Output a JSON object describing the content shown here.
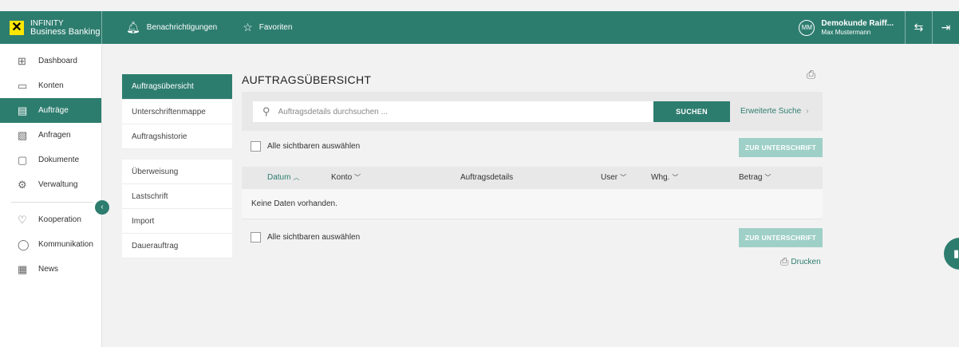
{
  "brand": {
    "line1": "INFINITY",
    "line2": "Business Banking",
    "logo": "✕"
  },
  "topnav": {
    "notifications": "Benachrichtigungen",
    "favorites": "Favoriten"
  },
  "user": {
    "initials": "MM",
    "company": "Demokunde Raiff...",
    "name": "Max Mustermann"
  },
  "sidebar": {
    "items": [
      {
        "label": "Dashboard",
        "icon": "dashboard-icon"
      },
      {
        "label": "Konten",
        "icon": "wallet-icon"
      },
      {
        "label": "Aufträge",
        "icon": "orders-icon",
        "active": true
      },
      {
        "label": "Anfragen",
        "icon": "requests-icon"
      },
      {
        "label": "Dokumente",
        "icon": "document-icon"
      },
      {
        "label": "Verwaltung",
        "icon": "settings-icon"
      }
    ],
    "items2": [
      {
        "label": "Kooperation",
        "icon": "handshake-icon"
      },
      {
        "label": "Kommunikation",
        "icon": "chat-icon"
      },
      {
        "label": "News",
        "icon": "news-icon"
      }
    ]
  },
  "subnav": {
    "group1": [
      "Auftragsübersicht",
      "Unterschriftenmappe",
      "Auftragshistorie"
    ],
    "group2": [
      "Überweisung",
      "Lastschrift",
      "Import",
      "Dauerauftrag"
    ]
  },
  "main": {
    "title": "AUFTRAGSÜBERSICHT",
    "search_placeholder": "Auftragsdetails durchsuchen ...",
    "search_button": "SUCHEN",
    "advanced_search": "Erweiterte Suche",
    "select_all": "Alle sichtbaren auswählen",
    "sign_button": "ZUR UNTERSCHRIFT",
    "columns": {
      "datum": "Datum",
      "konto": "Konto",
      "details": "Auftragsdetails",
      "user": "User",
      "whg": "Whg.",
      "betrag": "Betrag"
    },
    "empty": "Keine Daten vorhanden.",
    "print": "Drucken"
  },
  "colors": {
    "primary": "#2d7d6f",
    "brand_yellow": "#ffe600",
    "disabled_button": "#9fd0c7"
  }
}
